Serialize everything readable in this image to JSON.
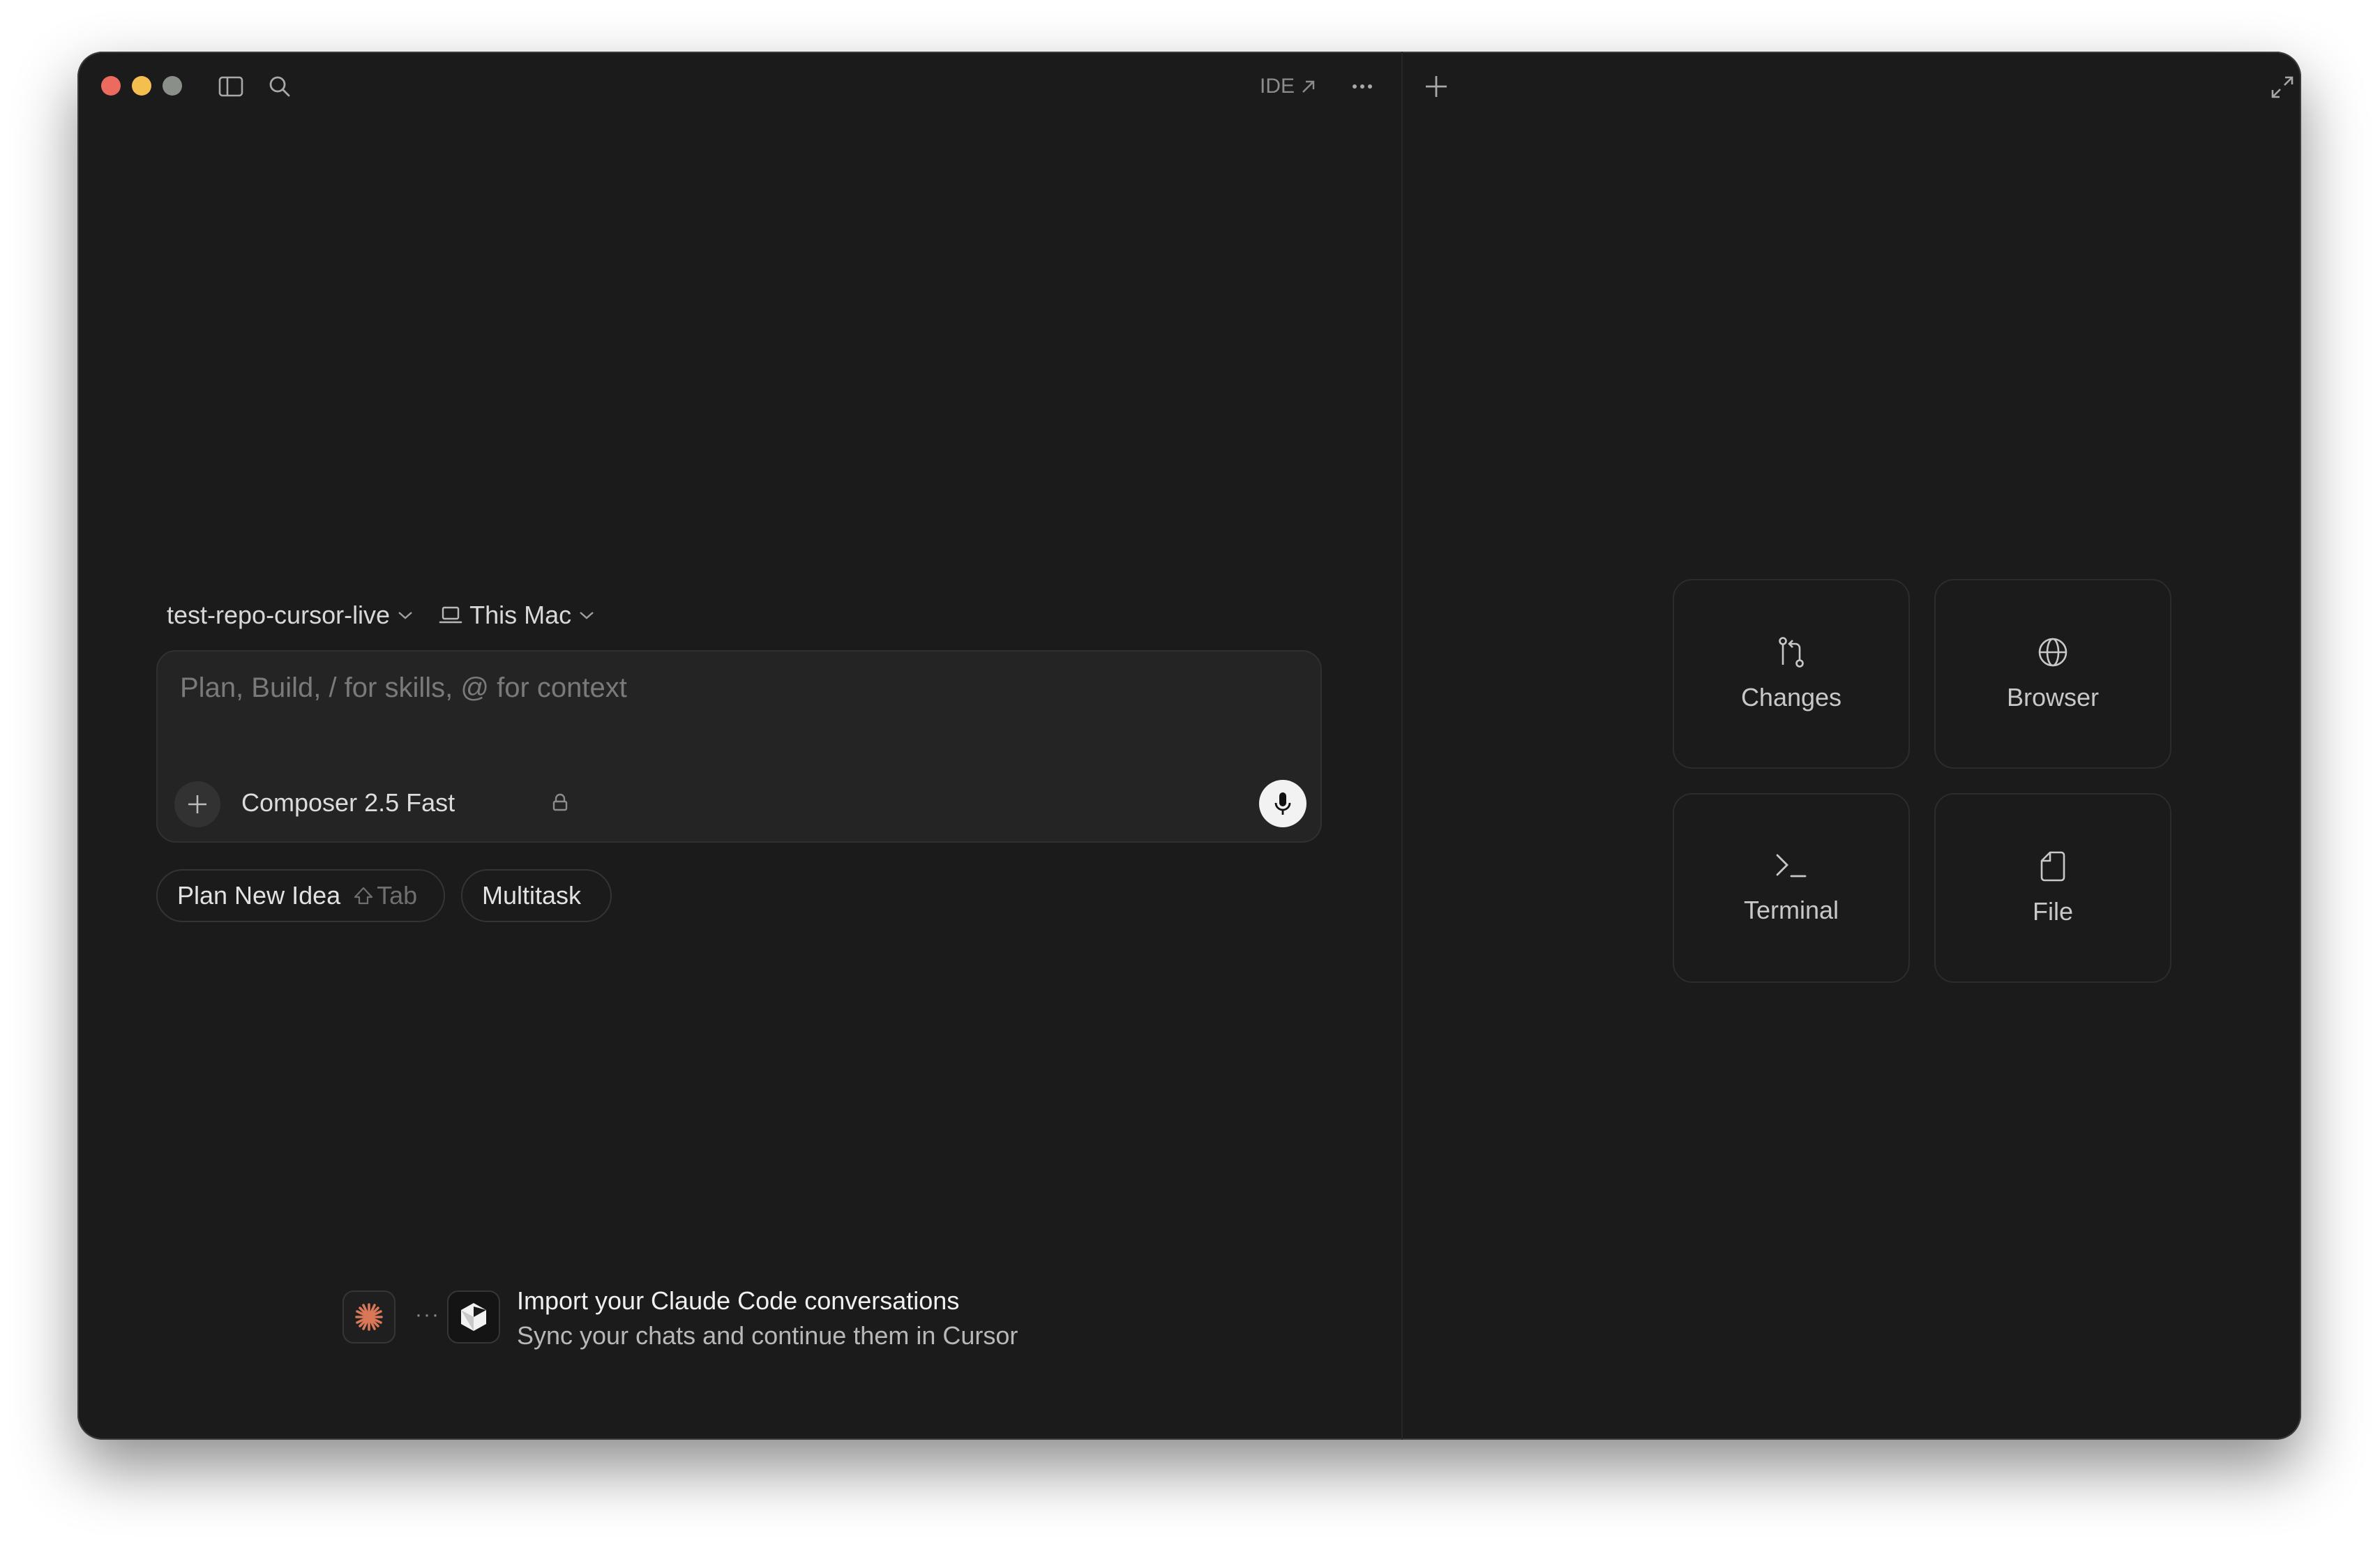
{
  "titlebar": {
    "ide_label": "IDE"
  },
  "context": {
    "repo": "test-repo-cursor-live",
    "machine": "This Mac"
  },
  "composer": {
    "placeholder": "Plan, Build, / for skills, @ for context",
    "model": "Composer 2.5 Fast"
  },
  "chips": [
    {
      "label": "Plan New Idea",
      "shortcut": "Tab"
    },
    {
      "label": "Multitask"
    }
  ],
  "import_banner": {
    "title": "Import your Claude Code conversations",
    "subtitle": "Sync your chats and continue them in Cursor",
    "separator": "···"
  },
  "panel_tiles": [
    {
      "label": "Changes",
      "icon": "git-compare-icon"
    },
    {
      "label": "Browser",
      "icon": "globe-icon"
    },
    {
      "label": "Terminal",
      "icon": "terminal-icon"
    },
    {
      "label": "File",
      "icon": "file-icon"
    }
  ],
  "colors": {
    "window_bg": "#1b1b1b",
    "close": "#ed6a5e",
    "minimize": "#f5bf4f",
    "zoom": "#8a8f89",
    "claude_accent": "#d97757"
  }
}
